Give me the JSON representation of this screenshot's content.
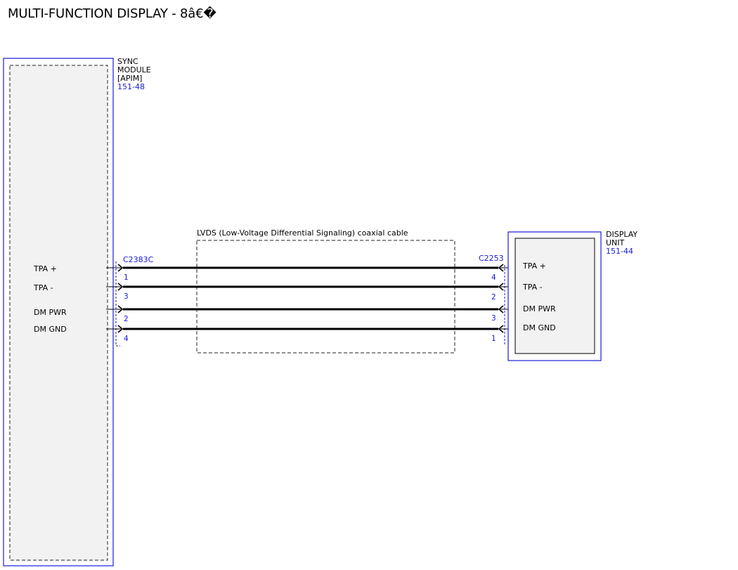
{
  "title": "MULTI-FUNCTION DISPLAY - 8â€�",
  "colors": {
    "reference_blue": "#1a1adc",
    "module_fill": "#f2f2f2",
    "wire": "#000000"
  },
  "sync_module": {
    "name_lines": [
      "SYNC",
      "MODULE",
      "[APIM]"
    ],
    "ref": "151-48",
    "connector": "C2383C",
    "pins": [
      {
        "signal": "TPA +",
        "pin": "1"
      },
      {
        "signal": "TPA -",
        "pin": "3"
      },
      {
        "signal": "DM PWR",
        "pin": "2"
      },
      {
        "signal": "DM GND",
        "pin": "4"
      }
    ]
  },
  "cable": {
    "label": "LVDS (Low-Voltage Differential Signaling) coaxial cable"
  },
  "display_unit": {
    "name_lines": [
      "DISPLAY",
      "UNIT"
    ],
    "ref": "151-44",
    "connector": "C2253",
    "pins": [
      {
        "signal": "TPA +",
        "pin": "4"
      },
      {
        "signal": "TPA -",
        "pin": "2"
      },
      {
        "signal": "DM PWR",
        "pin": "3"
      },
      {
        "signal": "DM GND",
        "pin": "1"
      }
    ]
  }
}
